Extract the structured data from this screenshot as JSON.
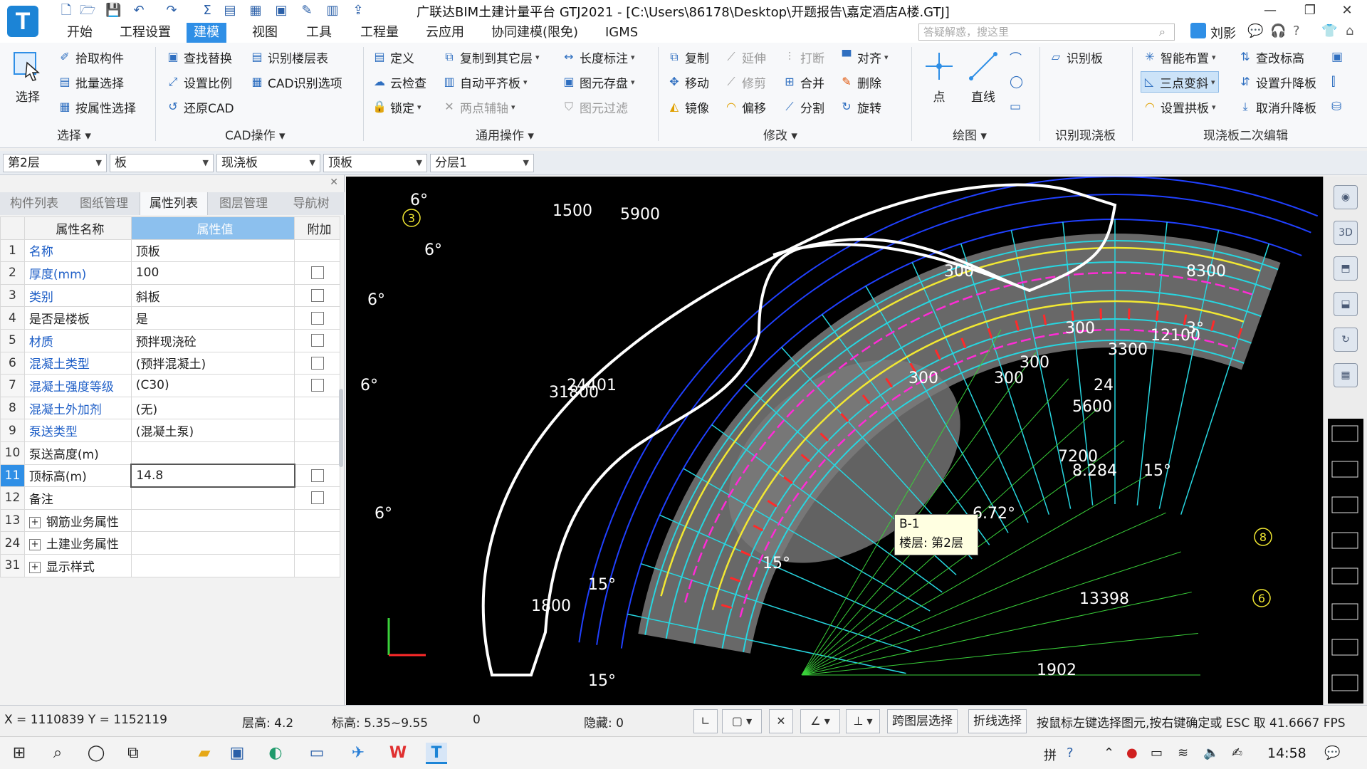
{
  "window": {
    "title": "广联达BIM土建计量平台 GTJ2021 - [C:\\Users\\86178\\Desktop\\开题报告\\嘉定酒店A楼.GTJ]",
    "logo_letter": "T",
    "controls": [
      "—",
      "❐",
      "✕"
    ]
  },
  "menu": {
    "items": [
      "开始",
      "工程设置",
      "建模",
      "视图",
      "工具",
      "工程量",
      "云应用",
      "协同建模(限免)",
      "IGMS"
    ],
    "active_index": 2,
    "search_placeholder": "答疑解惑，搜这里",
    "user_name": "刘影"
  },
  "ribbon": {
    "groups": {
      "select": "选择",
      "cad": "CAD操作",
      "general": "通用操作",
      "modify": "修改",
      "draw": "绘图",
      "recognize_slab": "识别现浇板",
      "slab_edit": "现浇板二次编辑"
    },
    "select_big": "选择",
    "select_items": [
      "拾取构件",
      "批量选择",
      "按属性选择"
    ],
    "cad_items": [
      "查找替换",
      "设置比例",
      "还原CAD",
      "识别楼层表",
      "CAD识别选项"
    ],
    "general_items": [
      "定义",
      "云检查",
      "锁定",
      "复制到其它层",
      "自动平齐板",
      "两点辅轴",
      "长度标注",
      "图元存盘",
      "图元过滤"
    ],
    "modify_items": [
      "复制",
      "移动",
      "镜像",
      "延伸",
      "修剪",
      "偏移",
      "打断",
      "合并",
      "分割",
      "对齐",
      "删除",
      "旋转"
    ],
    "draw_items": [
      "点",
      "直线"
    ],
    "recognize_items": [
      "识别板"
    ],
    "slab_items": [
      "智能布置",
      "三点变斜",
      "设置拱板",
      "查改标高",
      "设置升降板",
      "取消升降板"
    ]
  },
  "selectors": [
    "第2层",
    "板",
    "现浇板",
    "顶板",
    "分层1"
  ],
  "left_panel": {
    "tabs": [
      "构件列表",
      "图纸管理",
      "属性列表",
      "图层管理",
      "导航树"
    ],
    "active_tab": 2,
    "columns": [
      "属性名称",
      "属性值",
      "附加"
    ],
    "rows": [
      {
        "idx": "1",
        "name": "名称",
        "value": "顶板",
        "blue": true,
        "checkbox": false
      },
      {
        "idx": "2",
        "name": "厚度(mm)",
        "value": "100",
        "blue": true,
        "checkbox": true
      },
      {
        "idx": "3",
        "name": "类别",
        "value": "斜板",
        "blue": true,
        "checkbox": true
      },
      {
        "idx": "4",
        "name": "是否是楼板",
        "value": "是",
        "blue": false,
        "checkbox": true
      },
      {
        "idx": "5",
        "name": "材质",
        "value": "预拌现浇砼",
        "blue": true,
        "checkbox": true
      },
      {
        "idx": "6",
        "name": "混凝土类型",
        "value": "(预拌混凝土)",
        "blue": true,
        "checkbox": true
      },
      {
        "idx": "7",
        "name": "混凝土强度等级",
        "value": "(C30)",
        "blue": true,
        "checkbox": true
      },
      {
        "idx": "8",
        "name": "混凝土外加剂",
        "value": "(无)",
        "blue": true,
        "checkbox": false
      },
      {
        "idx": "9",
        "name": "泵送类型",
        "value": "(混凝土泵)",
        "blue": true,
        "checkbox": false
      },
      {
        "idx": "10",
        "name": "泵送高度(m)",
        "value": "",
        "blue": false,
        "checkbox": false
      },
      {
        "idx": "11",
        "name": "顶标高(m)",
        "value": "14.8",
        "blue": false,
        "checkbox": true,
        "selected": true
      },
      {
        "idx": "12",
        "name": "备注",
        "value": "",
        "blue": false,
        "checkbox": true
      },
      {
        "idx": "13",
        "name": "钢筋业务属性",
        "value": "",
        "blue": false,
        "checkbox": false,
        "expander": true
      },
      {
        "idx": "24",
        "name": "土建业务属性",
        "value": "",
        "blue": false,
        "checkbox": false,
        "expander": true
      },
      {
        "idx": "31",
        "name": "显示样式",
        "value": "",
        "blue": false,
        "checkbox": false,
        "expander": true
      }
    ]
  },
  "canvas": {
    "tooltip_line1": "B-1",
    "tooltip_line2": "楼层: 第2层",
    "dimension_labels": [
      "1500",
      "5900",
      "31800",
      "24401",
      "300",
      "300",
      "300",
      "300",
      "300",
      "3300",
      "5600",
      "7200",
      "8.284",
      "6.72°",
      "6°",
      "6°",
      "6°",
      "6°",
      "6°",
      "15°",
      "15°",
      "15°",
      "15°",
      "1800",
      "13398",
      "1902",
      "8300",
      "3°",
      "12100",
      "24"
    ],
    "axis_labels": [
      "3",
      "8",
      "6"
    ],
    "colors": {
      "background": "#000000",
      "grid_cyan": "#27d6e0",
      "slab_gray": "#7a7a7a",
      "magenta": "#ff2bd6",
      "yellow": "#f2e832",
      "red": "#ff2a2a",
      "white_outline": "#ffffff",
      "green": "#3ad13a",
      "blue": "#2040ff"
    }
  },
  "statusbar": {
    "coords": "X = 1110839 Y = 1152119",
    "floor_height": "层高:   4.2",
    "elevation": "标高:   5.35~9.55",
    "zero": "0",
    "hidden": "隐藏:  0",
    "btn_cross_layer": "跨图层选择",
    "btn_polyline": "折线选择",
    "hint": "按鼠标左键选择图元,按右键确定或 ESC 取 41.6667 FPS"
  },
  "taskbar": {
    "clock": "14:58",
    "ime": "拼"
  }
}
